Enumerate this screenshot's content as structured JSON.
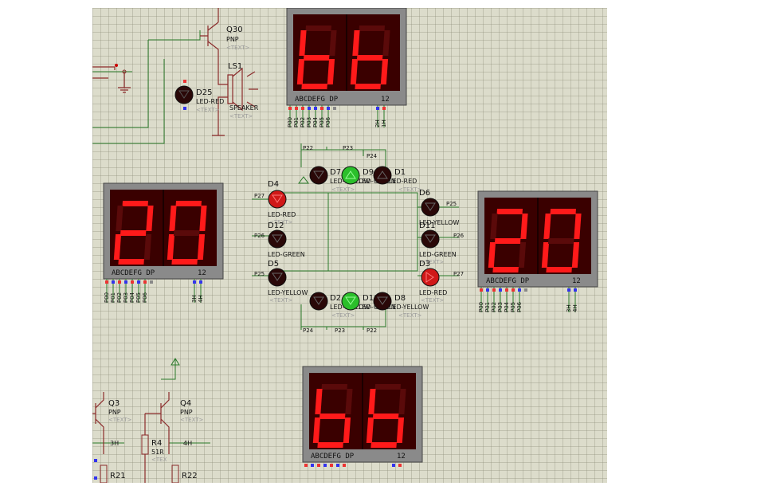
{
  "window": {
    "kind": "schematic-canvas"
  },
  "displays": {
    "top": {
      "digits": "bb",
      "pins": "ABCDEFG  DP",
      "pin_num": "12",
      "pins_bottom": [
        "P00",
        "P01",
        "P02",
        "P03",
        "P04",
        "P05",
        "P06"
      ],
      "pins_right": [
        "2H",
        "1H"
      ]
    },
    "left": {
      "digits": "20",
      "pins": "ABCDEFG  DP",
      "pin_num": "12",
      "pins_bottom": [
        "P00",
        "P01",
        "P02",
        "P03",
        "P04",
        "P05",
        "P06"
      ],
      "pins_right": [
        "3H",
        "4H"
      ]
    },
    "right": {
      "digits": "20",
      "pins": "ABCDEFG  DP",
      "pin_num": "12",
      "pins_bottom": [
        "P00",
        "P01",
        "P02",
        "P03",
        "P04",
        "P05",
        "P06"
      ],
      "pins_right": [
        "3H",
        "4H"
      ]
    },
    "bottom": {
      "digits": "bb",
      "pins": "ABCDEFG  DP",
      "pin_num": "12"
    }
  },
  "components": {
    "q30": {
      "name": "Q30",
      "type": "PNP",
      "text": "<TEXT>"
    },
    "ls1": {
      "name": "LS1",
      "type": "SPEAKER",
      "text": "<TEXT>"
    },
    "d25": {
      "name": "D25",
      "type": "LED-RED",
      "text": "<TEXT>"
    },
    "q3": {
      "name": "Q3",
      "type": "PNP",
      "text": "<TEXT>"
    },
    "q4": {
      "name": "Q4",
      "type": "PNP",
      "text": "<TEXT>"
    },
    "r4": {
      "name": "R4",
      "value": "51R",
      "text": "<TEX"
    },
    "r21": {
      "name": "R21"
    },
    "r22": {
      "name": "R22"
    },
    "net_3h": "3H",
    "net_4h": "4H"
  },
  "leds": {
    "d4": {
      "name": "D4",
      "type": "LED-RED",
      "net": "P27",
      "state": "on-red"
    },
    "d12": {
      "name": "D12",
      "type": "LED-GREEN",
      "net": "P26",
      "state": "off"
    },
    "d5": {
      "name": "D5",
      "type": "LED-YELLOW",
      "net": "P25",
      "state": "off"
    },
    "d7": {
      "name": "D7",
      "type": "LED-YELLOW",
      "net": "P22",
      "state": "off"
    },
    "d9": {
      "name": "D9",
      "type": "LED-GREEN",
      "net": "P23",
      "state": "on-green"
    },
    "d1": {
      "name": "D1",
      "type": "LED-RED",
      "net": "P24",
      "state": "off"
    },
    "d6": {
      "name": "D6",
      "type": "LED-YELLOW",
      "net": "P25",
      "state": "off"
    },
    "d11": {
      "name": "D11",
      "type": "LED-GREEN",
      "net": "P26",
      "state": "off"
    },
    "d3": {
      "name": "D3",
      "type": "LED-RED",
      "net": "P27",
      "state": "on-red"
    },
    "d2": {
      "name": "D2",
      "type": "LED-YELLOW",
      "net": "P24",
      "state": "off"
    },
    "d10": {
      "name": "D10",
      "type": "LED-GREEN",
      "net": "P23",
      "state": "on-green"
    },
    "d8": {
      "name": "D8",
      "type": "LED-YELLOW",
      "net": "P22",
      "state": "off"
    }
  },
  "led_text": "<TEXT>",
  "colors": {
    "canvas": "#dcdccb",
    "display_frame": "#8a8a8a",
    "display_body": "#3a0000",
    "segment_on": "#ff1a1a",
    "segment_off": "#5a0a0a",
    "led_off": "#2a0808",
    "led_red_on": "#d01818",
    "led_green_on": "#2bbf2b",
    "wire": "#2a7a2a",
    "component": "#8b2b2b"
  }
}
